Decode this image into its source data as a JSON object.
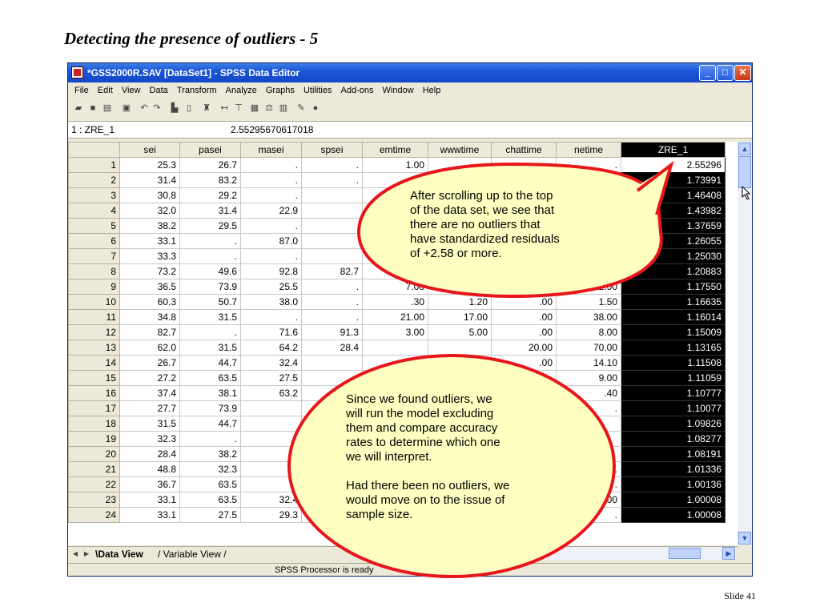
{
  "slide": {
    "title": "Detecting the presence of outliers - 5",
    "number": "Slide 41"
  },
  "window": {
    "title": "*GSS2000R.SAV [DataSet1] - SPSS Data Editor",
    "minimize": "_",
    "maximize": "□",
    "close": "✕"
  },
  "menu": [
    "File",
    "Edit",
    "View",
    "Data",
    "Transform",
    "Analyze",
    "Graphs",
    "Utilities",
    "Add-ons",
    "Window",
    "Help"
  ],
  "cell": {
    "ref": "1 : ZRE_1",
    "value": "2.55295670617018"
  },
  "grid": {
    "columns": [
      "sei",
      "pasei",
      "masei",
      "spsei",
      "emtime",
      "wwwtime",
      "chattime",
      "netime",
      "ZRE_1"
    ],
    "rows": [
      [
        "1",
        "25.3",
        "26.7",
        ".",
        ".",
        "1.00",
        "",
        "",
        ".",
        "2.55296"
      ],
      [
        "2",
        "31.4",
        "83.2",
        ".",
        ".",
        "",
        "",
        "",
        "",
        "1.73991"
      ],
      [
        "3",
        "30.8",
        "29.2",
        ".",
        "",
        "",
        "",
        "",
        "",
        "1.46408"
      ],
      [
        "4",
        "32.0",
        "31.4",
        "22.9",
        "",
        "",
        "",
        "",
        "",
        "1.43982"
      ],
      [
        "5",
        "38.2",
        "29.5",
        ".",
        "",
        "",
        "",
        "",
        "",
        "1.37659"
      ],
      [
        "6",
        "33.1",
        ".",
        "87.0",
        "",
        "",
        "",
        "",
        "",
        "1.26055"
      ],
      [
        "7",
        "33.3",
        ".",
        ".",
        "",
        "",
        "",
        "",
        "",
        "1.25030"
      ],
      [
        "8",
        "73.2",
        "49.6",
        "92.8",
        "82.7",
        "",
        "",
        "",
        "",
        "1.20883"
      ],
      [
        "9",
        "36.5",
        "73.9",
        "25.5",
        ".",
        "7.00",
        "",
        ".00",
        "22.00",
        "1.17550"
      ],
      [
        "10",
        "60.3",
        "50.7",
        "38.0",
        ".",
        ".30",
        "1.20",
        ".00",
        "1.50",
        "1.16635"
      ],
      [
        "11",
        "34.8",
        "31.5",
        ".",
        ".",
        "21.00",
        "17.00",
        ".00",
        "38.00",
        "1.16014"
      ],
      [
        "12",
        "82.7",
        ".",
        "71.6",
        "91.3",
        "3.00",
        "5.00",
        ".00",
        "8.00",
        "1.15009"
      ],
      [
        "13",
        "62.0",
        "31.5",
        "64.2",
        "28.4",
        "",
        "",
        "20.00",
        "70.00",
        "1.13165"
      ],
      [
        "14",
        "26.7",
        "44.7",
        "32.4",
        "",
        "",
        "",
        ".00",
        "14.10",
        "1.11508"
      ],
      [
        "15",
        "27.2",
        "63.5",
        "27.5",
        "",
        "",
        "",
        "",
        "9.00",
        "1.11059"
      ],
      [
        "16",
        "37.4",
        "38.1",
        "63.2",
        "",
        "",
        "",
        "",
        ".40",
        "1.10777"
      ],
      [
        "17",
        "27.7",
        "73.9",
        "",
        "",
        "",
        "",
        "",
        ".",
        "1.10077"
      ],
      [
        "18",
        "31.5",
        "44.7",
        "",
        "",
        "",
        "",
        "",
        "",
        "1.09826"
      ],
      [
        "19",
        "32.3",
        ".",
        "",
        "",
        "",
        "",
        "",
        "",
        "1.08277"
      ],
      [
        "20",
        "28.4",
        "38.2",
        "",
        "",
        "",
        "",
        "",
        "",
        "1.08191"
      ],
      [
        "21",
        "48.8",
        "32.3",
        "",
        "",
        "",
        "",
        "",
        ".",
        "1.01336"
      ],
      [
        "22",
        "36.7",
        "63.5",
        "",
        "",
        "",
        "",
        "",
        ".",
        "1.00136"
      ],
      [
        "23",
        "33.1",
        "63.5",
        "32.4",
        "",
        "",
        "",
        "",
        "55.00",
        "1.00008"
      ],
      [
        "24",
        "33.1",
        "27.5",
        "29.3",
        "",
        "",
        "",
        "",
        ".",
        "1.00008"
      ]
    ]
  },
  "tabs": {
    "data_view": "Data View",
    "variable_view": "Variable View"
  },
  "status": "SPSS Processor is ready",
  "callouts": {
    "top": [
      "After scrolling up to the top",
      "of the data set, we see that",
      "there are no outliers that",
      "have standardized residuals",
      "of +2.58 or more."
    ],
    "bottom": [
      "Since we found outliers, we",
      "will run the model excluding",
      "them and compare accuracy",
      "rates to determine which one",
      "we will interpret.",
      "",
      "Had there been no outliers, we",
      "would move on to the issue of",
      "sample size."
    ]
  },
  "colors": {
    "callout_fill": "#ffffc2",
    "callout_border": "#e8161c",
    "selected_column": "#000000"
  }
}
